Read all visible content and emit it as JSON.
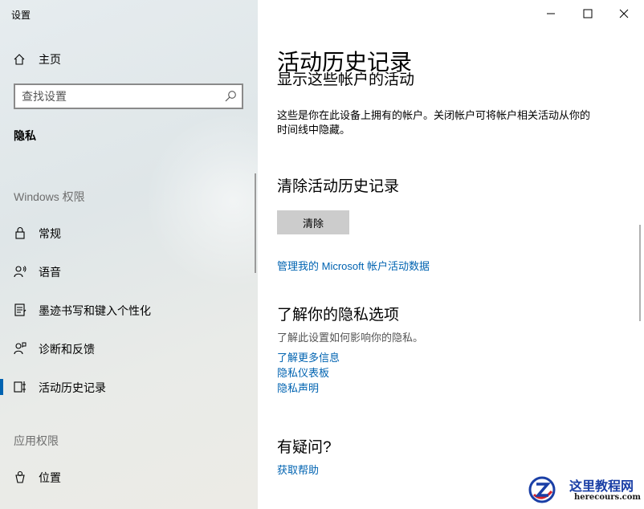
{
  "window": {
    "title": "设置"
  },
  "sidebar": {
    "home_label": "主页",
    "search_placeholder": "查找设置",
    "section": "隐私",
    "group_windows": "Windows 权限",
    "group_app": "应用权限",
    "items": [
      {
        "label": "常规",
        "icon": "lock-icon"
      },
      {
        "label": "语音",
        "icon": "speech-icon"
      },
      {
        "label": "墨迹书写和键入个性化",
        "icon": "inking-icon"
      },
      {
        "label": "诊断和反馈",
        "icon": "feedback-icon"
      },
      {
        "label": "活动历史记录",
        "icon": "timeline-icon",
        "selected": true
      },
      {
        "label": "位置",
        "icon": "location-icon"
      }
    ]
  },
  "content": {
    "title": "活动历史记录",
    "accounts_heading": "显示这些帐户的活动",
    "accounts_desc_line1": "这些是你在此设备上拥有的帐户。关闭帐户可将帐户相关活动从你的",
    "accounts_desc_line2": "时间线中隐藏。",
    "clear_heading": "清除活动历史记录",
    "clear_button": "清除",
    "manage_link": "管理我的 Microsoft 帐户活动数据",
    "privacy_heading": "了解你的隐私选项",
    "privacy_desc": "了解此设置如何影响你的隐私。",
    "links": [
      "了解更多信息",
      "隐私仪表板",
      "隐私声明"
    ],
    "question_heading": "有疑问?",
    "help_link": "获取帮助"
  },
  "watermark": {
    "title": "这里教程网",
    "url": "herecours.com"
  },
  "colors": {
    "accent": "#0063b1",
    "sidebar_bg": "#e4eaec",
    "button_bg": "#cccccc"
  }
}
